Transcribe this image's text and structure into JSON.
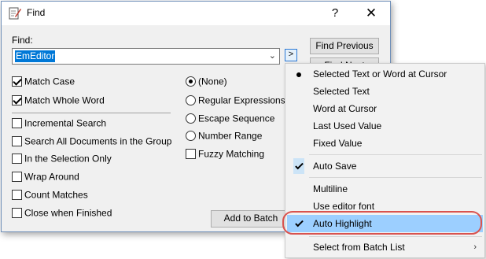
{
  "window": {
    "title": "Find",
    "help_label": "?",
    "close_label": "✕",
    "icon": "find-app-icon"
  },
  "find": {
    "label": "Find:",
    "value": "EmEditor",
    "more_label": ">"
  },
  "buttons": {
    "find_previous": "Find Previous",
    "find_next": "Find Next",
    "add_to_batch": "Add to Batch"
  },
  "options_left": [
    {
      "label": "Match Case",
      "checked": true
    },
    {
      "label": "Match Whole Word",
      "checked": true
    },
    {
      "label": "Incremental Search",
      "checked": false
    },
    {
      "label": "Search All Documents in the Group",
      "checked": false
    },
    {
      "label": "In the Selection Only",
      "checked": false
    },
    {
      "label": "Wrap Around",
      "checked": false
    },
    {
      "label": "Count Matches",
      "checked": false
    },
    {
      "label": "Close when Finished",
      "checked": false
    }
  ],
  "options_right": {
    "radios": [
      {
        "label": "(None)",
        "checked": true
      },
      {
        "label": "Regular Expressions",
        "checked": false
      },
      {
        "label": "Escape Sequence",
        "checked": false
      },
      {
        "label": "Number Range",
        "checked": false
      }
    ],
    "fuzzy": {
      "label": "Fuzzy Matching",
      "checked": false
    }
  },
  "menu": {
    "items": [
      {
        "label": "Selected Text or Word at Cursor",
        "mark": "dot"
      },
      {
        "label": "Selected Text",
        "mark": ""
      },
      {
        "label": "Word at Cursor",
        "mark": ""
      },
      {
        "label": "Last Used Value",
        "mark": ""
      },
      {
        "label": "Fixed Value",
        "mark": ""
      },
      {
        "label": "Auto Save",
        "mark": "check"
      },
      {
        "label": "Multiline",
        "mark": ""
      },
      {
        "label": "Use editor font",
        "mark": ""
      },
      {
        "label": "Auto Highlight",
        "mark": "check",
        "highlighted": true
      },
      {
        "label": "Select from Batch List",
        "mark": "",
        "submenu": true
      }
    ],
    "submenu_arrow": "›"
  },
  "colors": {
    "accent": "#0078d7",
    "highlight": "#9ccfff",
    "annotation_ring": "#d9534f"
  }
}
